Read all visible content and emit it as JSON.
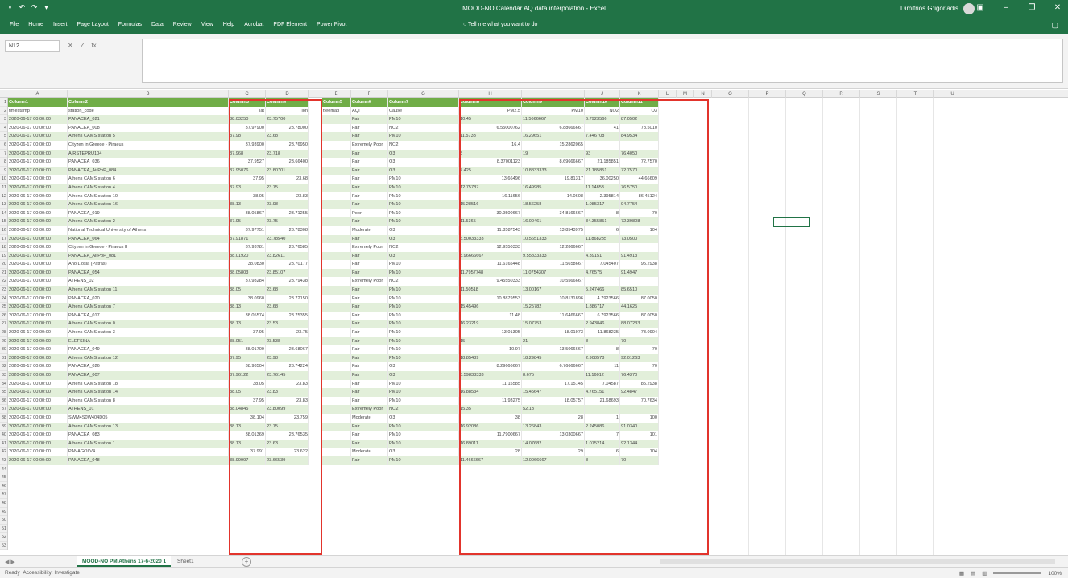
{
  "window": {
    "title": "MOOD-NO Calendar AQ data interpolation - Excel",
    "user": "Dimitrios Grigoriadis",
    "quick_access": [
      "save-icon",
      "undo-icon",
      "redo-icon",
      "customize-icon"
    ]
  },
  "ribbon": {
    "tabs": [
      "File",
      "Home",
      "Insert",
      "Page Layout",
      "Formulas",
      "Data",
      "Review",
      "View",
      "Help",
      "Acrobat",
      "PDF Element",
      "Power Pivot"
    ],
    "tell_me": "Tell me what you want to do"
  },
  "formula_bar": {
    "name_box": "N12",
    "content": ""
  },
  "columns": [
    "A",
    "B",
    "C",
    "D",
    "E",
    "F",
    "G",
    "H",
    "I",
    "J",
    "K",
    "L",
    "M",
    "N",
    "O",
    "P",
    "Q",
    "R",
    "S",
    "T",
    "U"
  ],
  "headers": [
    "Column1",
    "Column2",
    "Column3",
    "Column4",
    "Column5",
    "Column6",
    "Column7",
    "Column8",
    "Column9",
    "Column10",
    "Column11"
  ],
  "subheaders": [
    "timestamp",
    "station_code",
    "lat",
    "lon",
    "tteemap",
    "AQI",
    "Cause",
    "PM2.5",
    "PM10",
    "NO2",
    "O3"
  ],
  "rows": [
    [
      "2020-06-17 00:00:00",
      "PANACEA_021",
      "38.03250",
      "23.75700",
      "",
      "Fair",
      "PM10",
      "10.45",
      "11.5666667",
      "6.7923566",
      "87.0502"
    ],
    [
      "2020-06-17 00:00:00",
      "PANACEA_008",
      "37.97900",
      "23.78000",
      "",
      "Fair",
      "NO2",
      "6.55000762",
      "6.88666667",
      "41",
      "78.5010"
    ],
    [
      "2020-06-17 00:00:00",
      "Athens CAMS station 5",
      "37.98",
      "23.68",
      "",
      "Fair",
      "PM10",
      "11.5733",
      "16.29651",
      "7.446708",
      "84.9534"
    ],
    [
      "2020-06-17 00:00:00",
      "Cityzen in Greece - Piraeus",
      "37.93900",
      "23.76950",
      "",
      "Extremely Poor",
      "NO2",
      "16.4",
      "15.2862065",
      "",
      ""
    ],
    [
      "2020-06-17 00:00:00",
      "AIRSTEPRU104",
      "37.968",
      "23.718",
      "",
      "Fair",
      "O3",
      "3",
      "19",
      "93",
      "76.4050"
    ],
    [
      "2020-06-17 00:00:00",
      "PANACEA_036",
      "37.9527",
      "23.66400",
      "",
      "Fair",
      "O3",
      "8.37001123",
      "8.69666667",
      "21.185851",
      "72.7570"
    ],
    [
      "2020-06-17 00:00:00",
      "PANACEA_AirPoP_084",
      "37.95076",
      "23.80701",
      "",
      "Fair",
      "O3",
      "7.425",
      "10.8833333",
      "21.185851",
      "72.7570"
    ],
    [
      "2020-06-17 00:00:00",
      "Athens CAMS station 6",
      "37.95",
      "23.68",
      "",
      "Fair",
      "PM10",
      "13.66496",
      "19.81317",
      "36.00250",
      "44.66609"
    ],
    [
      "2020-06-17 00:00:00",
      "Athens CAMS station 4",
      "37.93",
      "23.75",
      "",
      "Fair",
      "PM10",
      "12.75787",
      "16.49985",
      "11.14853",
      "76.5750"
    ],
    [
      "2020-06-17 00:00:00",
      "Athens CAMS station 10",
      "38.05",
      "23.83",
      "",
      "Fair",
      "PM10",
      "16.11656",
      "14.0608",
      "2.395814",
      "86.45124"
    ],
    [
      "2020-06-17 00:00:00",
      "Athens CAMS station 16",
      "38.13",
      "23.98",
      "",
      "Fair",
      "PM10",
      "15.28516",
      "18.56258",
      "1.085317",
      "94.7754"
    ],
    [
      "2020-06-17 00:00:00",
      "PANACEA_019",
      "38.05867",
      "23.71255",
      "",
      "Poor",
      "PM10",
      "30.9500667",
      "34.8166667",
      "8",
      "70"
    ],
    [
      "2020-06-17 00:00:00",
      "Athens CAMS station 2",
      "37.95",
      "23.75",
      "",
      "Fair",
      "PM10",
      "11.5365",
      "16.00461",
      "34.355851",
      "72.39808"
    ],
    [
      "2020-06-17 00:00:00",
      "National Technical University of Athens",
      "37.97751",
      "23.78308",
      "",
      "Moderate",
      "O3",
      "11.8587543",
      "13.8543975",
      "6",
      "104"
    ],
    [
      "2020-06-17 00:00:00",
      "PANACEA_064",
      "37.91871",
      "23.78540",
      "",
      "Fair",
      "O3",
      "5.50033333",
      "10.5651333",
      "11.868235",
      "73.0500"
    ],
    [
      "2020-06-17 00:00:00",
      "Cityzen in Greece - Piraeus II",
      "37.93781",
      "23.76585",
      "",
      "Extremely Poor",
      "NO2",
      "12.9550333",
      "12.2866667",
      "",
      ""
    ],
    [
      "2020-06-17 00:00:00",
      "PANACEA_AirPoP_081",
      "38.01920",
      "23.82611",
      "",
      "Fair",
      "O3",
      "3.96666667",
      "9.55833333",
      "4.39151",
      "91.4913"
    ],
    [
      "2020-06-17 00:00:00",
      "Ano Liosia (Patras)",
      "38.0830",
      "23.70177",
      "",
      "Fair",
      "PM10",
      "11.6165448",
      "11.5658667",
      "7.045407",
      "95.2938"
    ],
    [
      "2020-06-17 00:00:00",
      "PANACEA_054",
      "38.05803",
      "23.85107",
      "",
      "Fair",
      "PM10",
      "11.7957748",
      "11.0754307",
      "4.76575",
      "91.4947"
    ],
    [
      "2020-06-17 00:00:00",
      "ATHENS_02",
      "37.98284",
      "23.79438",
      "",
      "Extremely Poor",
      "NO2",
      "9.45550333",
      "10.5566667",
      "",
      ""
    ],
    [
      "2020-06-17 00:00:00",
      "Athens CAMS station 11",
      "38.05",
      "23.68",
      "",
      "Fair",
      "PM10",
      "11.50518",
      "13.00167",
      "5.247466",
      "85.6510"
    ],
    [
      "2020-06-17 00:00:00",
      "PANACEA_020",
      "38.0960",
      "23.72150",
      "",
      "Fair",
      "PM10",
      "10.8879553",
      "10.8131896",
      "4.7923566",
      "87.0050"
    ],
    [
      "2020-06-17 00:00:00",
      "Athens CAMS station 7",
      "38.13",
      "23.68",
      "",
      "Fair",
      "PM10",
      "15.45496",
      "15.25782",
      "1.886717",
      "44.1625"
    ],
    [
      "2020-06-17 00:00:00",
      "PANACEA_017",
      "38.05574",
      "23.75355",
      "",
      "Fair",
      "PM10",
      "11.48",
      "11.6466667",
      "6.7923566",
      "87.0050"
    ],
    [
      "2020-06-17 00:00:00",
      "Athens CAMS station 0",
      "38.13",
      "23.53",
      "",
      "Fair",
      "PM10",
      "16.23219",
      "15.07753",
      "2.943846",
      "88.07233"
    ],
    [
      "2020-06-17 00:00:00",
      "Athens CAMS station 3",
      "37.95",
      "23.75",
      "",
      "Fair",
      "PM10",
      "13.01305",
      "18.01973",
      "11.868235",
      "73.0904"
    ],
    [
      "2020-06-17 00:00:00",
      "ELEFSINA",
      "38.051",
      "23.538",
      "",
      "Fair",
      "PM10",
      "15",
      "21",
      "8",
      "70"
    ],
    [
      "2020-06-17 00:00:00",
      "PANACEA_049",
      "38.01709",
      "23.68067",
      "",
      "Fair",
      "PM10",
      "10.97",
      "13.5066667",
      "8",
      "70"
    ],
    [
      "2020-06-17 00:00:00",
      "Athens CAMS station 12",
      "37.95",
      "23.98",
      "",
      "Fair",
      "PM10",
      "18.85489",
      "18.29845",
      "2.908578",
      "92.01263"
    ],
    [
      "2020-06-17 00:00:00",
      "PANACEA_026",
      "38.98504",
      "23.74224",
      "",
      "Fair",
      "O3",
      "8.29666667",
      "6.76666667",
      "11",
      "70"
    ],
    [
      "2020-06-17 00:00:00",
      "PANACEA_007",
      "37.96122",
      "23.76145",
      "",
      "Fair",
      "O3",
      "8.59833333",
      "8.675",
      "11.16012",
      "76.4370"
    ],
    [
      "2020-06-17 00:00:00",
      "Athens CAMS station 18",
      "38.05",
      "23.83",
      "",
      "Fair",
      "PM10",
      "11.15585",
      "17.15145",
      "7.04587",
      "85.2938"
    ],
    [
      "2020-06-17 00:00:00",
      "Athens CAMS station 14",
      "38.05",
      "23.83",
      "",
      "Fair",
      "PM10",
      "16.88534",
      "15.45647",
      "4.765151",
      "92.4847"
    ],
    [
      "2020-06-17 00:00:00",
      "Athens CAMS station 8",
      "37.95",
      "23.83",
      "",
      "Fair",
      "PM10",
      "11.93275",
      "18.05757",
      "21.68693",
      "70.7634"
    ],
    [
      "2020-06-17 00:00:00",
      "ATHENS_01",
      "38.04845",
      "23.80099",
      "",
      "Extremely Poor",
      "NO2",
      "15.35",
      "52.13",
      "",
      ""
    ],
    [
      "2020-06-17 00:00:00",
      "SWM4S0W404D05",
      "38.104",
      "23.759",
      "",
      "Moderate",
      "O3",
      "38",
      "28",
      "1",
      "100"
    ],
    [
      "2020-06-17 00:00:00",
      "Athens CAMS station 13",
      "38.13",
      "23.75",
      "",
      "Fair",
      "PM10",
      "16.92086",
      "13.26843",
      "2.245086",
      "91.0340"
    ],
    [
      "2020-06-17 00:00:00",
      "PANACEA_083",
      "38.01369",
      "23.76535",
      "",
      "Fair",
      "PM10",
      "11.7900667",
      "13.0300667",
      "7",
      "101"
    ],
    [
      "2020-06-17 00:00:00",
      "Athens CAMS station 1",
      "38.13",
      "23.63",
      "",
      "Fair",
      "PM10",
      "16.89011",
      "14.07682",
      "1.075214",
      "92.1344"
    ],
    [
      "2020-06-17 00:00:00",
      "PANAGOLV4",
      "37.991",
      "23.622",
      "",
      "Moderate",
      "O3",
      "28",
      "29",
      "6",
      "104"
    ],
    [
      "2020-06-17 00:00:00",
      "PANACEA_048",
      "38.99997",
      "23.66539",
      "",
      "Fair",
      "PM10",
      "11.4666667",
      "12.0066667",
      "8",
      "70"
    ]
  ],
  "sheet_tabs": [
    "MOOD-NO PM Athens 17-6-2020 1",
    "Sheet1"
  ],
  "status": {
    "left": "Ready",
    "accessibility": "Accessibility: Investigate",
    "zoom": "100%"
  }
}
